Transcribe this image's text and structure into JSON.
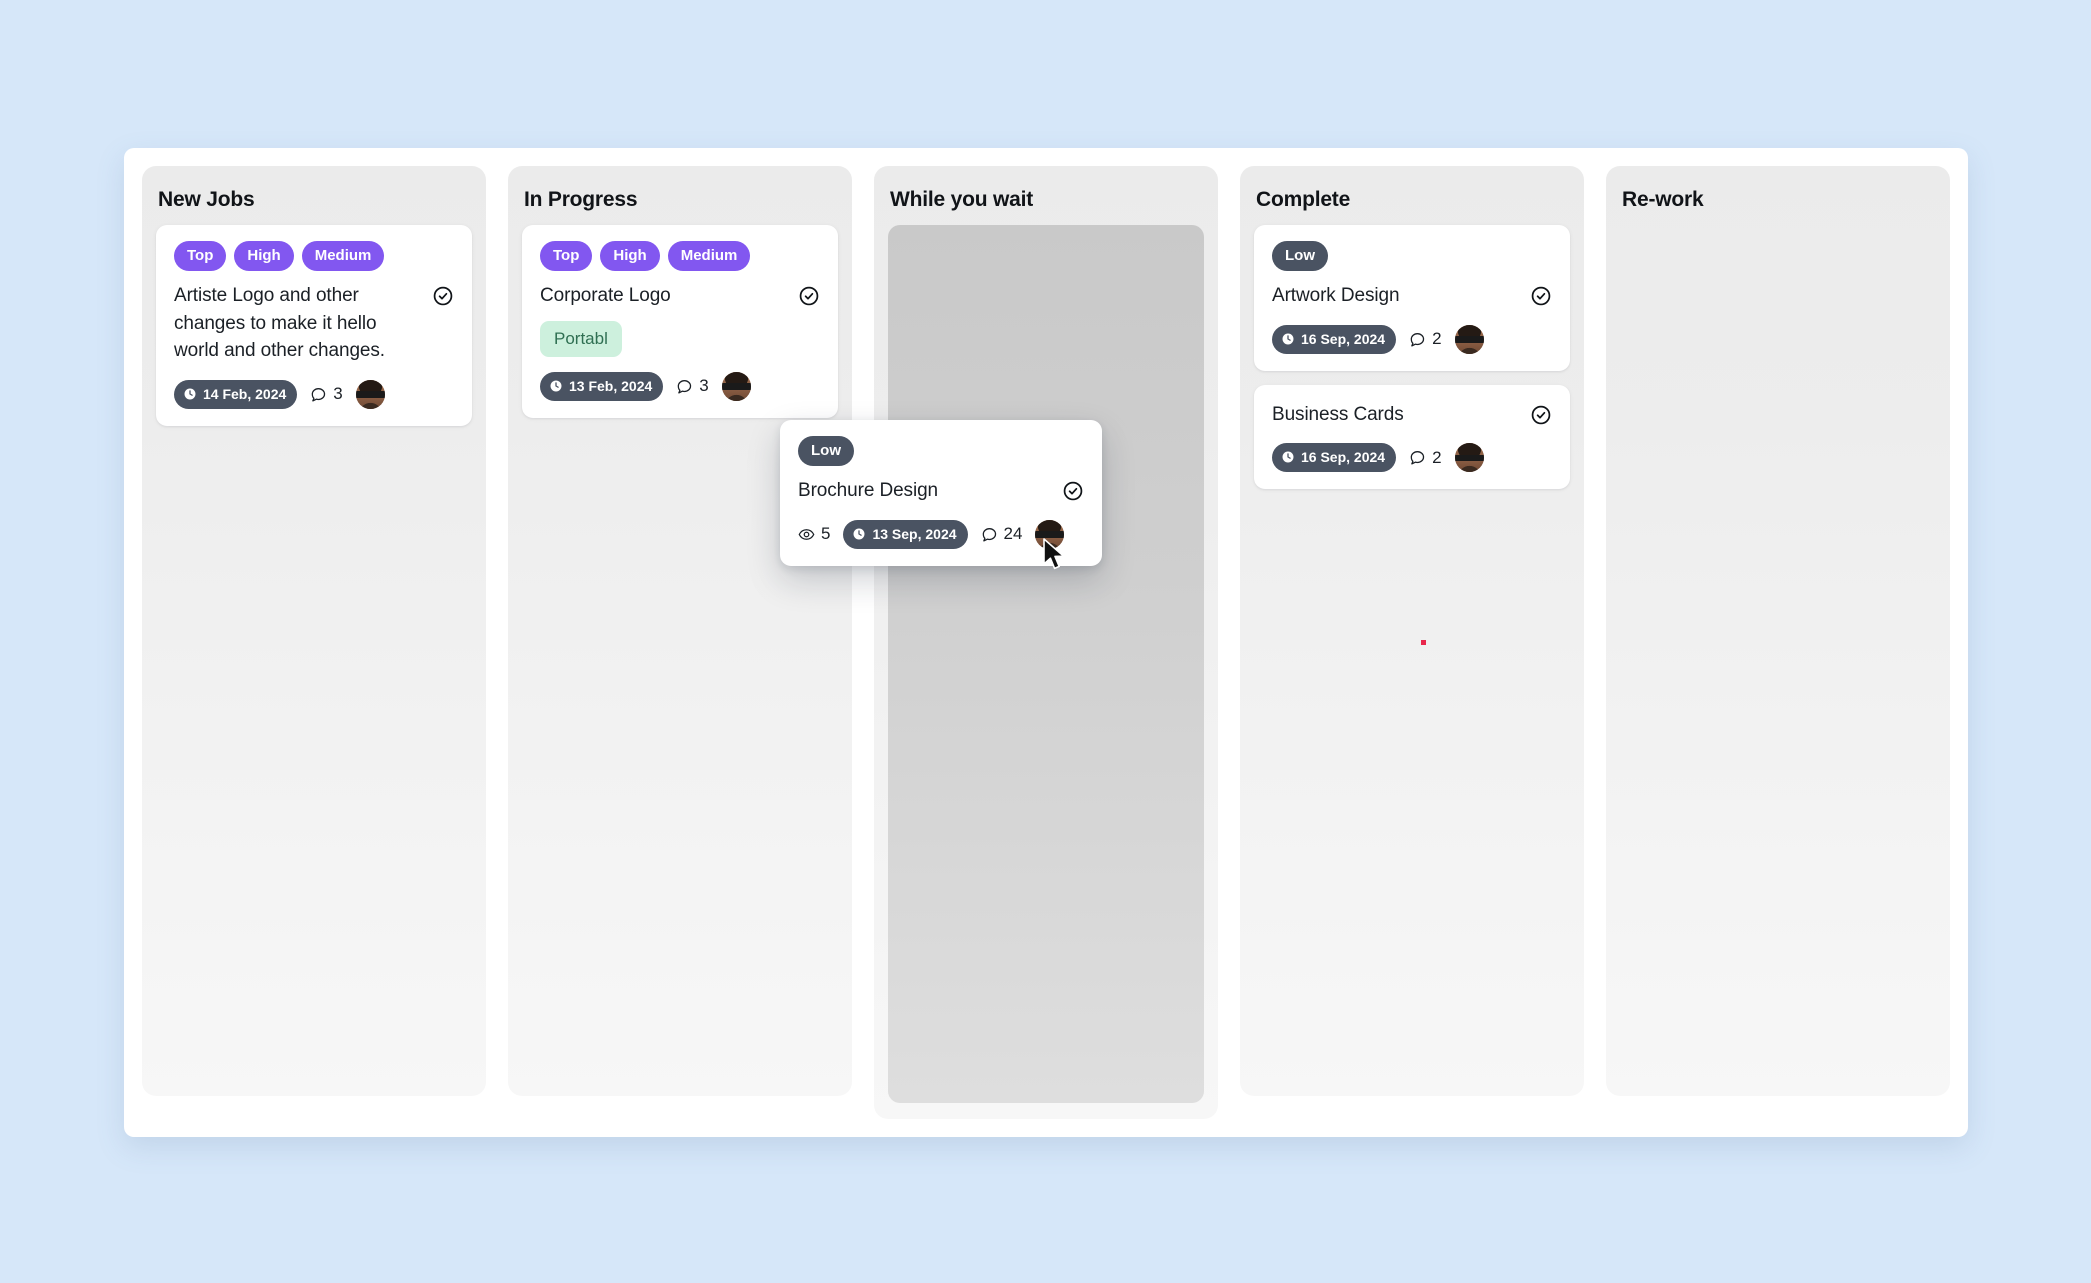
{
  "theme": {
    "page_background": "#d6e7f9",
    "board_background": "#ffffff",
    "column_background_top": "#ebebeb",
    "column_background_bottom": "#f7f7f7",
    "chip_purple": "#8257f0",
    "chip_slate": "#4a5362",
    "tag_green_bg": "#cdf0dd",
    "tag_green_text": "#2f6f52",
    "drop_placeholder": "#c9c9c9",
    "red_dot": "#e8274b"
  },
  "board": {
    "columns": [
      {
        "title": "New Jobs",
        "cards": [
          {
            "chips": [
              {
                "label": "Top",
                "style": "purple"
              },
              {
                "label": "High",
                "style": "purple"
              },
              {
                "label": "Medium",
                "style": "purple"
              }
            ],
            "title": "Artiste Logo and other changes to make it hello world and other changes.",
            "tags": [],
            "views": null,
            "date": "14 Feb, 2024",
            "comments": "3",
            "has_check": true,
            "has_avatar": true
          }
        ],
        "placeholder": false
      },
      {
        "title": "In Progress",
        "cards": [
          {
            "chips": [
              {
                "label": "Top",
                "style": "purple"
              },
              {
                "label": "High",
                "style": "purple"
              },
              {
                "label": "Medium",
                "style": "purple"
              }
            ],
            "title": "Corporate Logo",
            "tags": [
              "Portabl"
            ],
            "views": null,
            "date": "13 Feb, 2024",
            "comments": "3",
            "has_check": true,
            "has_avatar": true
          }
        ],
        "placeholder": false
      },
      {
        "title": "While you wait",
        "cards": [],
        "placeholder": true
      },
      {
        "title": "Complete",
        "cards": [
          {
            "chips": [
              {
                "label": "Low",
                "style": "slate"
              }
            ],
            "title": "Artwork Design",
            "tags": [],
            "views": null,
            "date": "16 Sep, 2024",
            "comments": "2",
            "has_check": true,
            "has_avatar": true
          },
          {
            "chips": [],
            "title": "Business Cards",
            "tags": [],
            "views": null,
            "date": "16 Sep, 2024",
            "comments": "2",
            "has_check": true,
            "has_avatar": true
          }
        ],
        "placeholder": false
      },
      {
        "title": "Re-work",
        "cards": [],
        "placeholder": false
      }
    ]
  },
  "dragging_card": {
    "chips": [
      {
        "label": "Low",
        "style": "slate"
      }
    ],
    "title": "Brochure Design",
    "tags": [],
    "views": "5",
    "date": "13 Sep, 2024",
    "comments": "24",
    "has_check": true,
    "has_avatar": true
  },
  "icons": {
    "check": "check-circle-icon",
    "clock": "clock-icon",
    "comment": "comment-bubble-icon",
    "eye": "eye-icon",
    "cursor": "mouse-pointer-icon"
  }
}
